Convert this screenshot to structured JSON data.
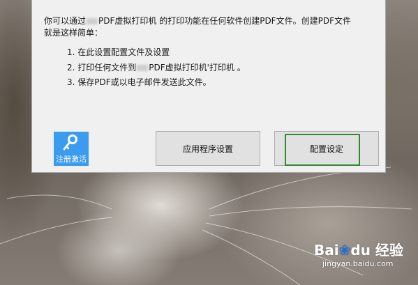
{
  "dialog": {
    "intro_line1_a": "你可以通过",
    "intro_line1_b": "PDF虚拟打印机 的打印功能在任何软件创建PDF文件。创建PDF文件",
    "intro_line2": "就是这样简单：",
    "steps": [
      {
        "text": "1. 在此设置配置文件及设置"
      },
      {
        "text_a": "2. 打印任何文件到",
        "text_b": "PDF虚拟打印机'打印机 。"
      },
      {
        "text": "3. 保存PDF或以电子邮件发送此文件。"
      }
    ],
    "register_label": "注册激活",
    "register_icon": "key-icon",
    "app_settings_button": "应用程序设置",
    "config_button": "配置设定",
    "highlight_color": "#2e8b2e",
    "accent_color": "#3a9bef"
  },
  "watermark": {
    "logo_a": "Bai",
    "logo_b": "du",
    "logo_c": "经验",
    "url": "jingyan.baidu.com"
  }
}
